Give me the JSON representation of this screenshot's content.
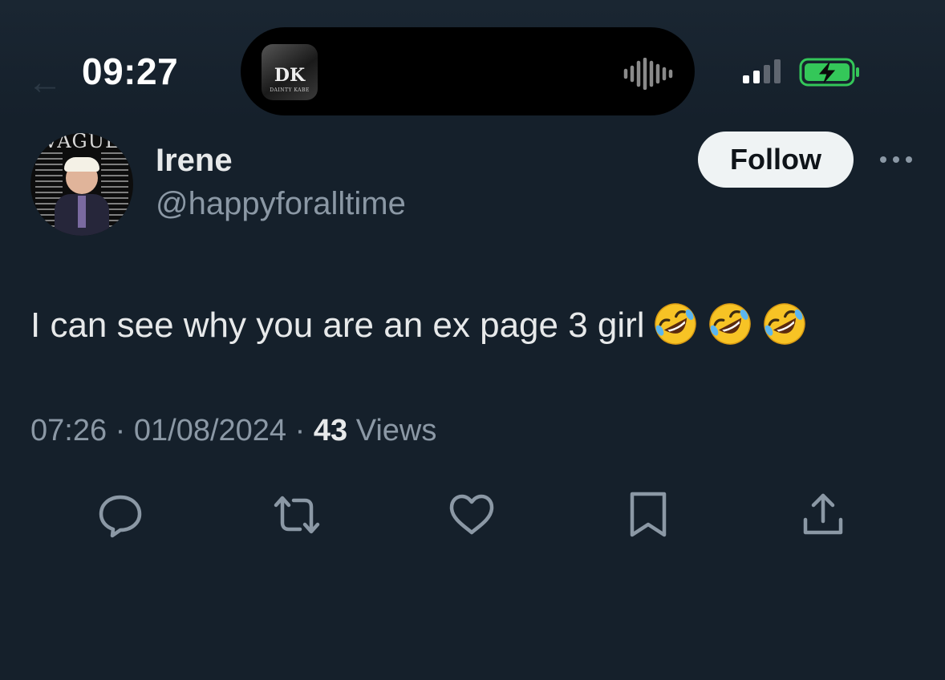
{
  "status_bar": {
    "time": "09:27",
    "now_playing_art": {
      "monogram": "DK",
      "brand": "DAINTY KABE"
    }
  },
  "tweet": {
    "author": {
      "name": "Irene",
      "handle": "@happyforalltime",
      "avatar_title": "VAGUE"
    },
    "follow_label": "Follow",
    "text": "I can see why you are an ex page 3 girl",
    "emojis": [
      "rolling-on-floor-laughing",
      "rolling-on-floor-laughing",
      "rolling-on-floor-laughing"
    ],
    "time": "07:26",
    "date": "01/08/2024",
    "separator": "·",
    "views_count": "43",
    "views_label": "Views"
  },
  "actions": [
    "reply-icon",
    "retweet-icon",
    "like-icon",
    "bookmark-icon",
    "share-icon"
  ],
  "colors": {
    "background": "#15202b",
    "primary_text": "#e7e9ea",
    "secondary_text": "#8b98a5",
    "battery_green": "#34c759"
  }
}
